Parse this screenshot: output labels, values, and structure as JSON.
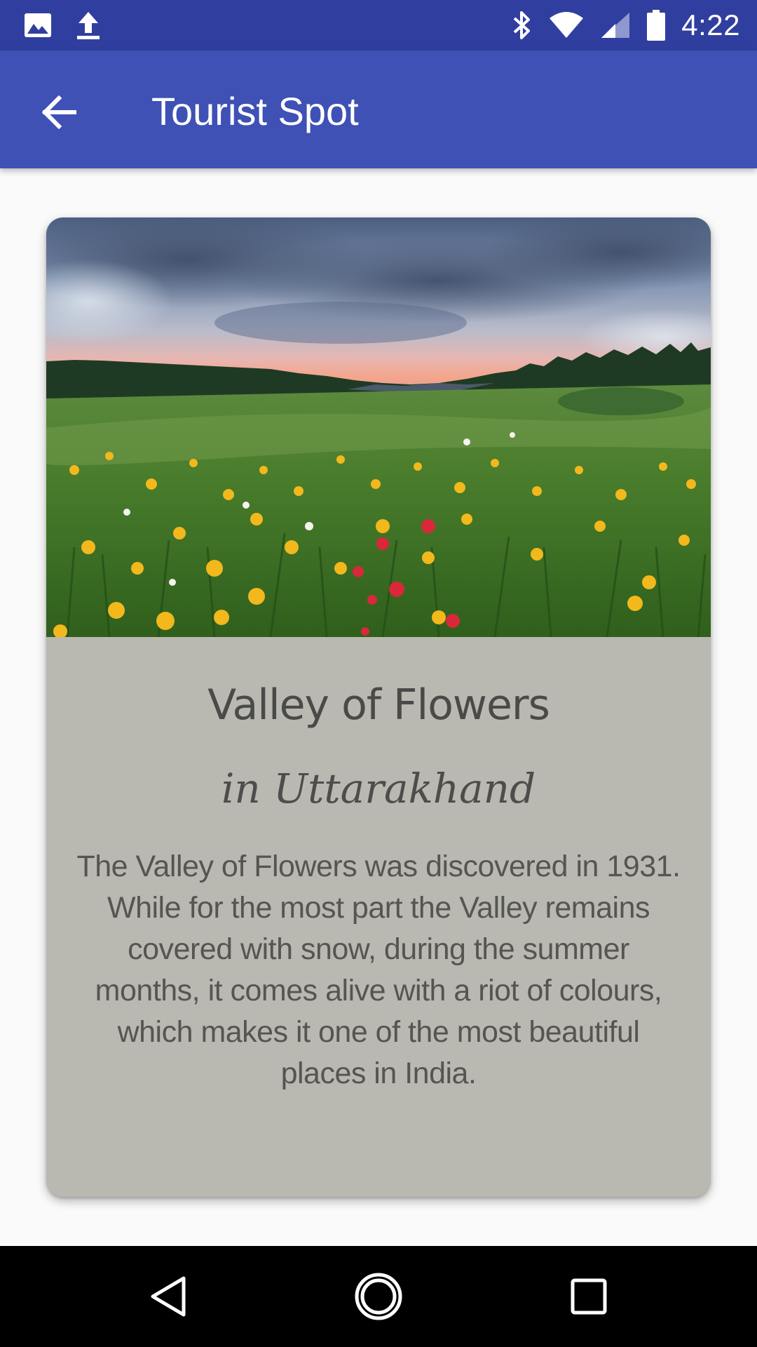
{
  "status_bar": {
    "time": "4:22",
    "left_icons": [
      "image-icon",
      "upload-icon"
    ],
    "right_icons": [
      "bluetooth-icon",
      "wifi-icon",
      "cell-signal-icon",
      "battery-icon"
    ]
  },
  "app_bar": {
    "title": "Tourist Spot",
    "nav_icon": "back-arrow-icon"
  },
  "card": {
    "image_subject": "meadow of wildflowers under a cloudy sunset sky",
    "name": "Valley of Flowers",
    "location": "in Uttarakhand",
    "description": "The Valley of Flowers was discovered in 1931. While for the most part the Valley remains covered with snow, during the summer months, it comes alive with a riot of colours, which makes it one of the most beautiful places in India."
  },
  "nav_bar": {
    "buttons": [
      "back-triangle-icon",
      "home-circle-icon",
      "recents-square-icon"
    ]
  },
  "colors": {
    "status_bar": "#303f9f",
    "app_bar": "#3f51b5",
    "card_background": "#b9b8b1",
    "page_background": "#fafafa",
    "nav_bar": "#000000"
  }
}
